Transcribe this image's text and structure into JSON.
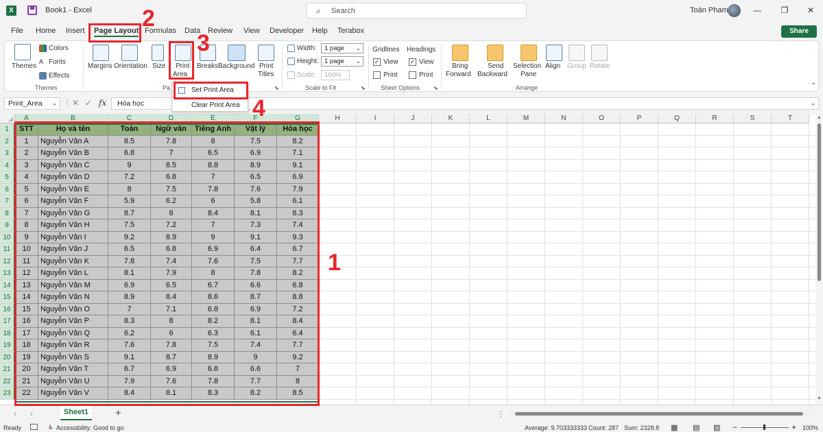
{
  "window": {
    "title": "Book1 - Excel",
    "search_placeholder": "Search",
    "user_name": "Toàn Pham",
    "minimize": "—",
    "restore": "❐",
    "close": "✕"
  },
  "tabs": [
    {
      "label": "File",
      "active": false
    },
    {
      "label": "Home",
      "active": false
    },
    {
      "label": "Insert",
      "active": false
    },
    {
      "label": "Page Layout",
      "active": true
    },
    {
      "label": "Formulas",
      "active": false
    },
    {
      "label": "Data",
      "active": false
    },
    {
      "label": "Review",
      "active": false
    },
    {
      "label": "View",
      "active": false
    },
    {
      "label": "Developer",
      "active": false
    },
    {
      "label": "Help",
      "active": false
    },
    {
      "label": "Terabox",
      "active": false
    }
  ],
  "share_label": "Share",
  "ribbon": {
    "themes": {
      "themes_label": "Themes",
      "colors_label": "Colors",
      "fonts_label": "Fonts",
      "effects_label": "Effects",
      "group_label": "Themes"
    },
    "page_setup": {
      "margins_label": "Margins",
      "orientation_label": "Orientation",
      "size_label": "Size",
      "print_area_line1": "Print",
      "print_area_line2": "Area",
      "breaks_label": "Breaks",
      "background_label": "Background",
      "print_titles_line1": "Print",
      "print_titles_line2": "Titles",
      "group_label": "Pa"
    },
    "scale_to_fit": {
      "width_label": "Width:",
      "width_value": "1 page",
      "height_label": "Height:",
      "height_value": "1 page",
      "scale_label": "Scale:",
      "scale_value": "100%",
      "group_label": "Scale to Fit"
    },
    "sheet_options": {
      "gridlines_label": "Gridlines",
      "headings_label": "Headings",
      "view_label": "View",
      "print_label": "Print",
      "gridlines_view": true,
      "gridlines_print": false,
      "headings_view": true,
      "headings_print": false,
      "group_label": "Sheet Options"
    },
    "arrange": {
      "bring_forward_line1": "Bring",
      "bring_forward_line2": "Forward",
      "send_backward_line1": "Send",
      "send_backward_line2": "Backward",
      "selection_pane_line1": "Selection",
      "selection_pane_line2": "Pane",
      "align_label": "Align",
      "group_btn_label": "Group",
      "rotate_label": "Rotate",
      "group_label": "Arrange"
    }
  },
  "print_area_menu": {
    "set": "Set Print Area",
    "clear": "Clear Print Area"
  },
  "formula_bar": {
    "name_box": "Print_Area",
    "fx": "fx",
    "content": "Hóa học"
  },
  "columns": [
    "A",
    "B",
    "C",
    "D",
    "E",
    "F",
    "G",
    "H",
    "I",
    "J",
    "K",
    "L",
    "M",
    "N",
    "O",
    "P",
    "Q",
    "R",
    "S",
    "T"
  ],
  "rows_visible": [
    "1",
    "2",
    "3",
    "4",
    "5",
    "6",
    "7",
    "8",
    "9",
    "10",
    "11",
    "12",
    "13",
    "14",
    "15",
    "16",
    "17",
    "18",
    "19",
    "20",
    "21",
    "22",
    "23"
  ],
  "table": {
    "headers": [
      "STT",
      "Họ và tên",
      "Toán",
      "Ngữ văn",
      "Tiếng Anh",
      "Vật lý",
      "Hóa học"
    ],
    "rows": [
      [
        "1",
        "Nguyễn Văn A",
        "8.5",
        "7.8",
        "8",
        "7.5",
        "8.2"
      ],
      [
        "2",
        "Nguyễn Văn B",
        "6.8",
        "7",
        "6.5",
        "6.9",
        "7.1"
      ],
      [
        "3",
        "Nguyễn Văn C",
        "9",
        "8.5",
        "8.8",
        "8.9",
        "9.1"
      ],
      [
        "4",
        "Nguyễn Văn D",
        "7.2",
        "6.8",
        "7",
        "6.5",
        "6.9"
      ],
      [
        "5",
        "Nguyễn Văn E",
        "8",
        "7.5",
        "7.8",
        "7.6",
        "7.9"
      ],
      [
        "6",
        "Nguyễn Văn F",
        "5.9",
        "6.2",
        "6",
        "5.8",
        "6.1"
      ],
      [
        "7",
        "Nguyễn Văn G",
        "8.7",
        "8",
        "8.4",
        "8.1",
        "8.3"
      ],
      [
        "8",
        "Nguyễn Văn H",
        "7.5",
        "7.2",
        "7",
        "7.3",
        "7.4"
      ],
      [
        "9",
        "Nguyễn Văn I",
        "9.2",
        "8.9",
        "9",
        "9.1",
        "9.3"
      ],
      [
        "10",
        "Nguyễn Văn J",
        "6.5",
        "6.8",
        "6.9",
        "6.4",
        "6.7"
      ],
      [
        "11",
        "Nguyễn Văn K",
        "7.8",
        "7.4",
        "7.6",
        "7.5",
        "7.7"
      ],
      [
        "12",
        "Nguyễn Văn L",
        "8.1",
        "7.9",
        "8",
        "7.8",
        "8.2"
      ],
      [
        "13",
        "Nguyễn Văn M",
        "6.9",
        "6.5",
        "6.7",
        "6.6",
        "6.8"
      ],
      [
        "14",
        "Nguyễn Văn N",
        "8.9",
        "8.4",
        "8.6",
        "8.7",
        "8.8"
      ],
      [
        "15",
        "Nguyễn Văn O",
        "7",
        "7.1",
        "6.8",
        "6.9",
        "7.2"
      ],
      [
        "16",
        "Nguyễn Văn P",
        "8.3",
        "8",
        "8.2",
        "8.1",
        "8.4"
      ],
      [
        "17",
        "Nguyễn Văn Q",
        "6.2",
        "6",
        "6.3",
        "6.1",
        "6.4"
      ],
      [
        "18",
        "Nguyễn Văn R",
        "7.6",
        "7.8",
        "7.5",
        "7.4",
        "7.7"
      ],
      [
        "19",
        "Nguyễn Văn S",
        "9.1",
        "8.7",
        "8.9",
        "9",
        "9.2"
      ],
      [
        "20",
        "Nguyễn Văn T",
        "6.7",
        "6.9",
        "6.8",
        "6.6",
        "7"
      ],
      [
        "21",
        "Nguyễn Văn U",
        "7.9",
        "7.6",
        "7.8",
        "7.7",
        "8"
      ],
      [
        "22",
        "Nguyễn Văn V",
        "8.4",
        "8.1",
        "8.3",
        "8.2",
        "8.5"
      ]
    ]
  },
  "annotations": [
    "1",
    "2",
    "3",
    "4"
  ],
  "sheet_tabs": [
    "Sheet1"
  ],
  "status": {
    "ready": "Ready",
    "accessibility": "Accessibility: Good to go",
    "average": "Average: 9.703333333",
    "count": "Count: 287",
    "sum": "Sum: 2328.8",
    "zoom": "100%"
  },
  "colors": {
    "excel_green": "#1e7145",
    "header_fill": "#93b27e",
    "body_fill": "#c9c9c9",
    "annotation_red": "#e8262b"
  }
}
